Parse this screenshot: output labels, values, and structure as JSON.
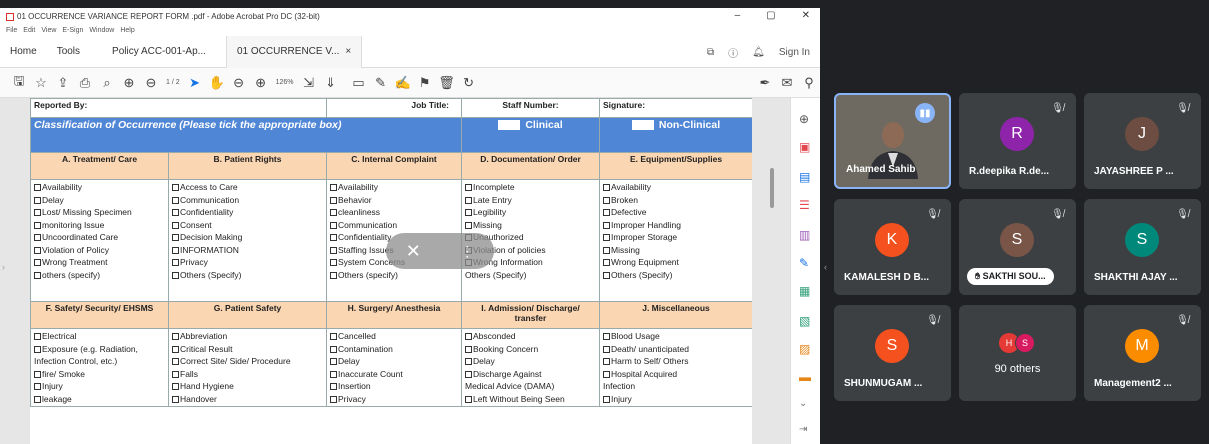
{
  "window": {
    "title": "01 OCCURRENCE VARIANCE REPORT FORM .pdf - Adobe Acrobat Pro DC (32-bit)",
    "pdf_icon": "pdf-icon",
    "min": "–",
    "max": "▢",
    "close": "✕"
  },
  "menu": [
    "File",
    "Edit",
    "View",
    "E-Sign",
    "Window",
    "Help"
  ],
  "tabs": {
    "home": "Home",
    "tools": "Tools",
    "tab1": "Policy ACC-001-Ap...",
    "tab2": "01 OCCURRENCE V...",
    "tab2_close": "×",
    "sign_in": "Sign In"
  },
  "toolbar": {
    "page_indicator": "1 / 2",
    "zoom": "126%"
  },
  "form": {
    "reported_by": "Reported By:",
    "job_title": "Job Title:",
    "staff_number": "Staff Number:",
    "signature": "Signature:",
    "classification": "Classification of Occurrence (Please tick the appropriate box)",
    "clinical": "Clinical",
    "non_clinical": "Non-Clinical",
    "row1_headers": [
      "A. Treatment/ Care",
      "B. Patient Rights",
      "C. Internal Complaint",
      "D. Documentation/ Order",
      "E. Equipment/Supplies"
    ],
    "row1_items": [
      [
        "Availability",
        "Delay",
        "Lost/ Missing Specimen",
        "monitoring Issue",
        "Uncoordinated Care",
        "Violation of Policy",
        "Wrong Treatment",
        "others (specify)"
      ],
      [
        "Access to Care",
        "Communication",
        "Confidentiality",
        "Consent",
        "Decision Making",
        "INFORMATION",
        "Privacy",
        "Others (Specify)"
      ],
      [
        "Availability",
        "Behavior",
        "cleanliness",
        "Communication",
        "Confidentiality",
        "Staffing Issues",
        "System Concerns",
        "Others (specify)"
      ],
      [
        "Incomplete",
        "Late Entry",
        "Legibility",
        "Missing",
        "Unauthorized",
        "Violation of policies",
        "Wrong Information",
        "Others (Specify)"
      ],
      [
        "Availability",
        "Broken",
        "Defective",
        "Improper Handling",
        "Improper Storage",
        "Missing",
        "Wrong Equipment",
        "Others (Specify)"
      ]
    ],
    "row2_headers": [
      "F. Safety/ Security/ EHSMS",
      "G. Patient Safety",
      "H. Surgery/ Anesthesia",
      "I. Admission/ Discharge/ transfer",
      "J. Miscellaneous"
    ],
    "row2_items": [
      [
        "Electrical",
        "Exposure (e.g. Radiation,",
        "Infection Control, etc.)",
        "fire/ Smoke",
        "Injury",
        "leakage"
      ],
      [
        "Abbreviation",
        "Critical Result",
        "Correct Site/ Side/ Procedure",
        "Falls",
        "Hand Hygiene",
        "Handover"
      ],
      [
        "Cancelled",
        "Contamination",
        "Delay",
        "Inaccurate Count",
        "Insertion",
        "Privacy"
      ],
      [
        "Absconded",
        "Booking Concern",
        "Delay",
        "Discharge Against",
        "Medical Advice (DAMA)",
        "Left Without Being Seen"
      ],
      [
        "Blood Usage",
        "Death/ unanticipated",
        "Harm to Self/ Others",
        "Hospital Acquired",
        "Infection",
        "Injury"
      ]
    ]
  },
  "participants": [
    {
      "name": "Ahamed Sahib",
      "video": true
    },
    {
      "name": "R.deepika R.de...",
      "initial": "R",
      "color": "#8e24aa"
    },
    {
      "name": "JAYASHREE P ...",
      "initial": "J",
      "color": "#6d4c41"
    },
    {
      "name": "KAMALESH D B...",
      "initial": "K",
      "color": "#f4511e"
    },
    {
      "name": "SAKTHI SOU...",
      "initial": "S",
      "color": "#795548"
    },
    {
      "name": "SHAKTHI AJAY ...",
      "initial": "S",
      "color": "#00897b"
    },
    {
      "name": "SHUNMUGAM ...",
      "initial": "S",
      "color": "#f4511e"
    },
    {
      "name": "90 others",
      "initials": [
        "H",
        "S"
      ],
      "colors": [
        "#e53935",
        "#d81b60"
      ]
    },
    {
      "name": "Management2 ...",
      "initial": "M",
      "color": "#fb8c00"
    }
  ],
  "colors": {
    "meet_bg": "#202124",
    "tile_bg": "#3c4043",
    "classification_blue": "#4f86d6",
    "category_peach": "#fbd6b2"
  }
}
